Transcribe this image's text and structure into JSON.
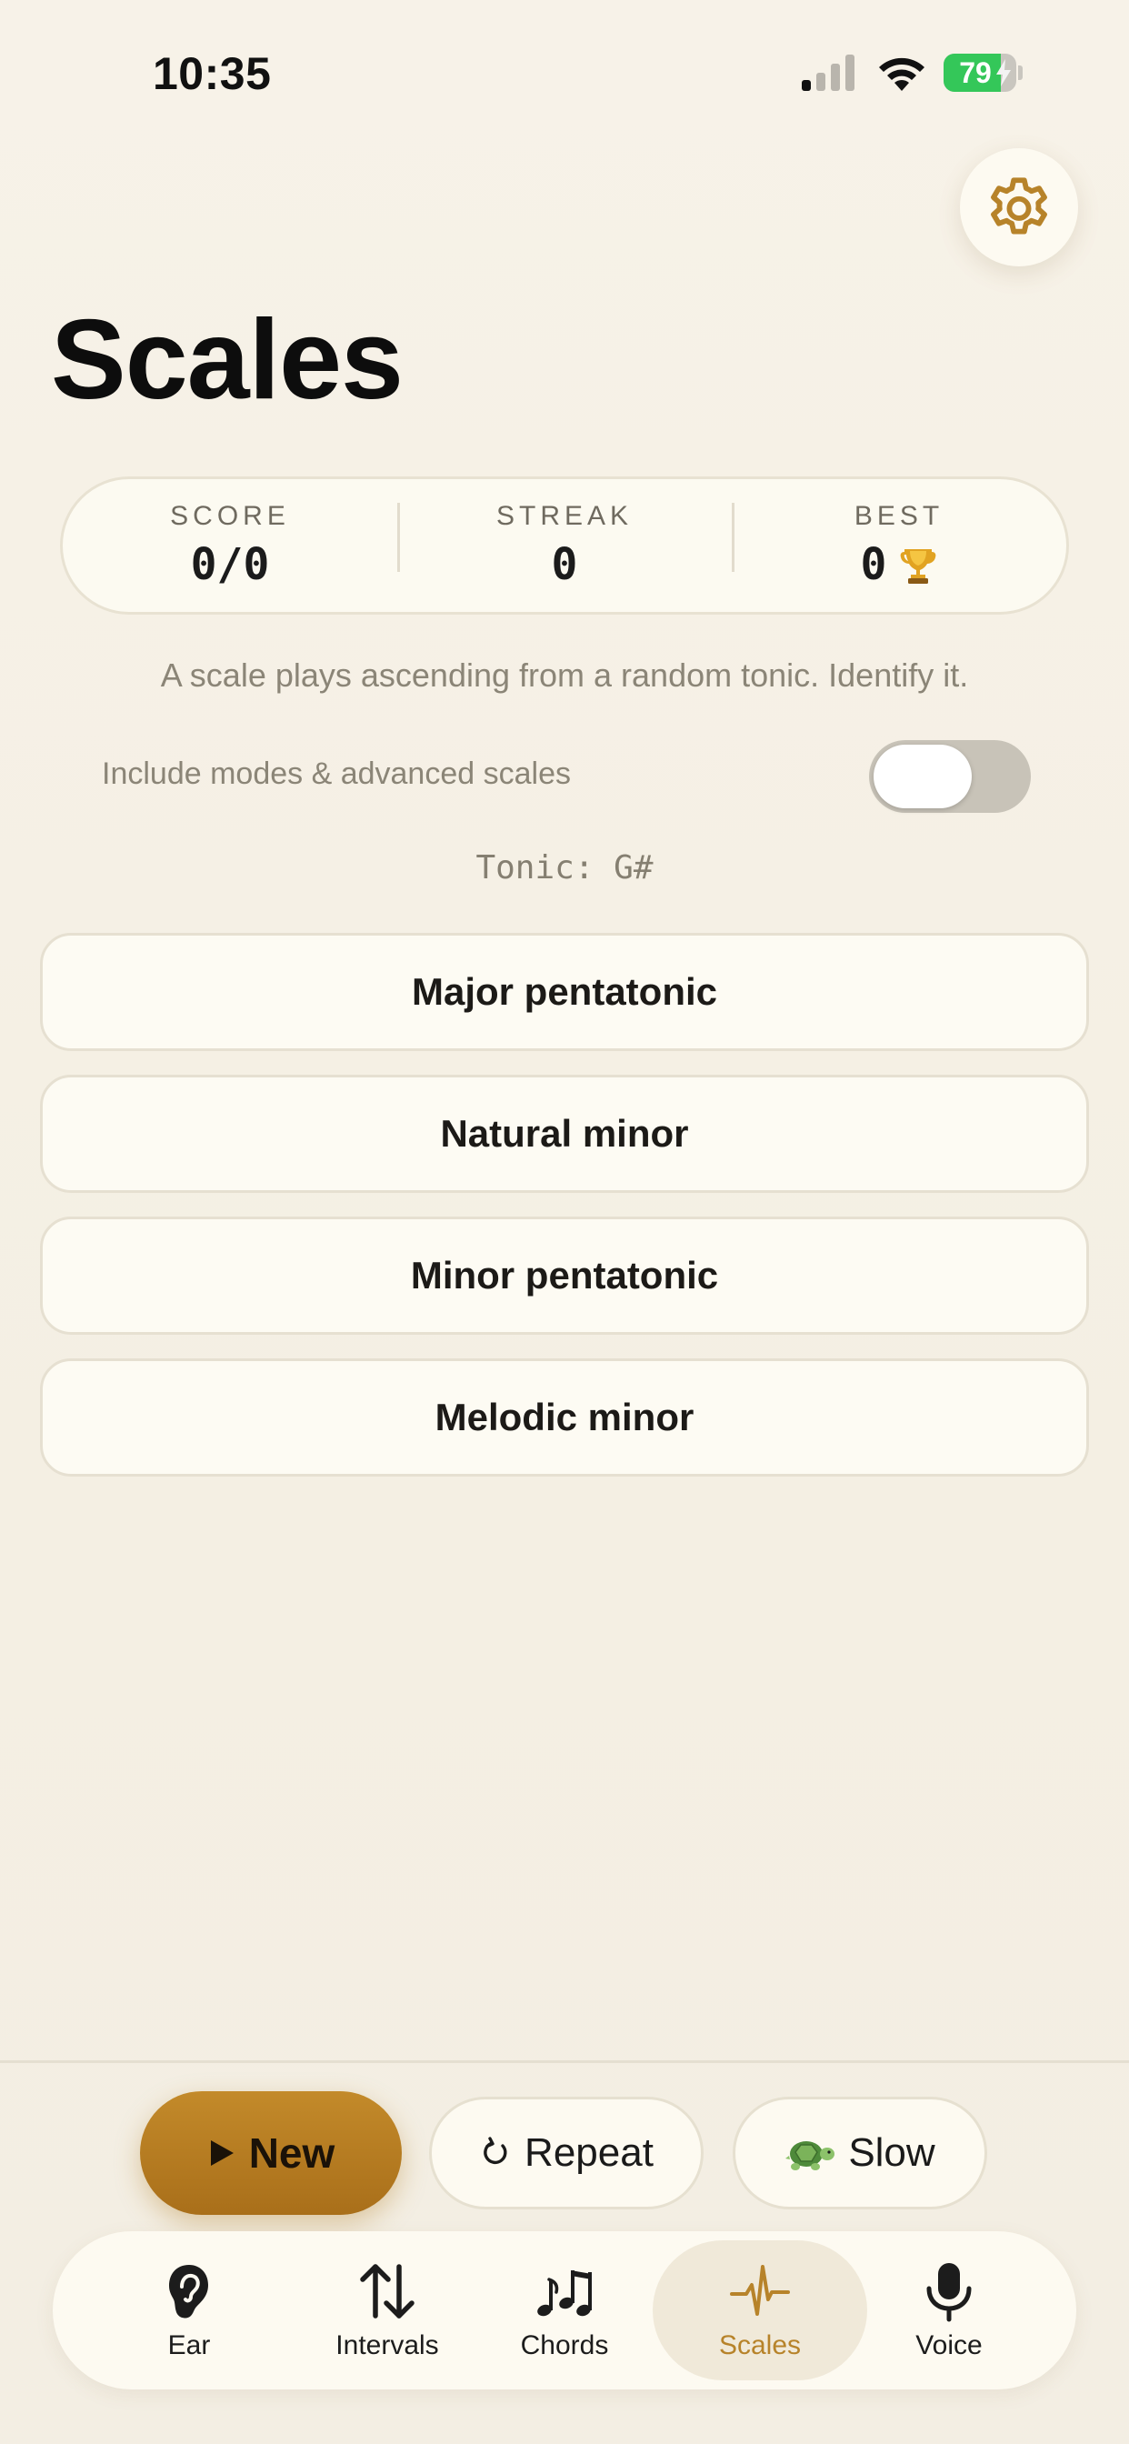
{
  "status_bar": {
    "time": "10:35",
    "battery_percent": 79,
    "battery_label": "79",
    "icons": [
      "signal-icon",
      "wifi-icon",
      "battery-icon",
      "charging-bolt-icon"
    ]
  },
  "header": {
    "settings_icon": "gear-icon",
    "title": "Scales"
  },
  "stats": {
    "score": {
      "label": "SCORE",
      "value": "0/0"
    },
    "streak": {
      "label": "STREAK",
      "value": "0"
    },
    "best": {
      "label": "BEST",
      "value": "0",
      "icon": "trophy-icon"
    }
  },
  "description": "A scale plays ascending from a random tonic. Identify it.",
  "toggle": {
    "label": "Include modes & advanced scales",
    "on": false
  },
  "tonic": "Tonic: G#",
  "answers": [
    {
      "label": "Major pentatonic"
    },
    {
      "label": "Natural minor"
    },
    {
      "label": "Minor pentatonic"
    },
    {
      "label": "Melodic minor"
    }
  ],
  "actions": {
    "new": {
      "label": "New",
      "icon": "play-icon"
    },
    "repeat": {
      "label": "Repeat",
      "icon": "repeat-icon"
    },
    "slow": {
      "label": "Slow",
      "icon": "turtle-icon"
    }
  },
  "tabs": [
    {
      "label": "Ear",
      "icon": "ear-icon",
      "active": false
    },
    {
      "label": "Intervals",
      "icon": "up-down-arrows-icon",
      "active": false
    },
    {
      "label": "Chords",
      "icon": "music-notes-icon",
      "active": false
    },
    {
      "label": "Scales",
      "icon": "waveform-icon",
      "active": true
    },
    {
      "label": "Voice",
      "icon": "microphone-icon",
      "active": false
    }
  ],
  "colors": {
    "accent": "#b7832a",
    "background": "#f5f0e5",
    "card": "#fcfaf1",
    "battery_green": "#34c759"
  }
}
